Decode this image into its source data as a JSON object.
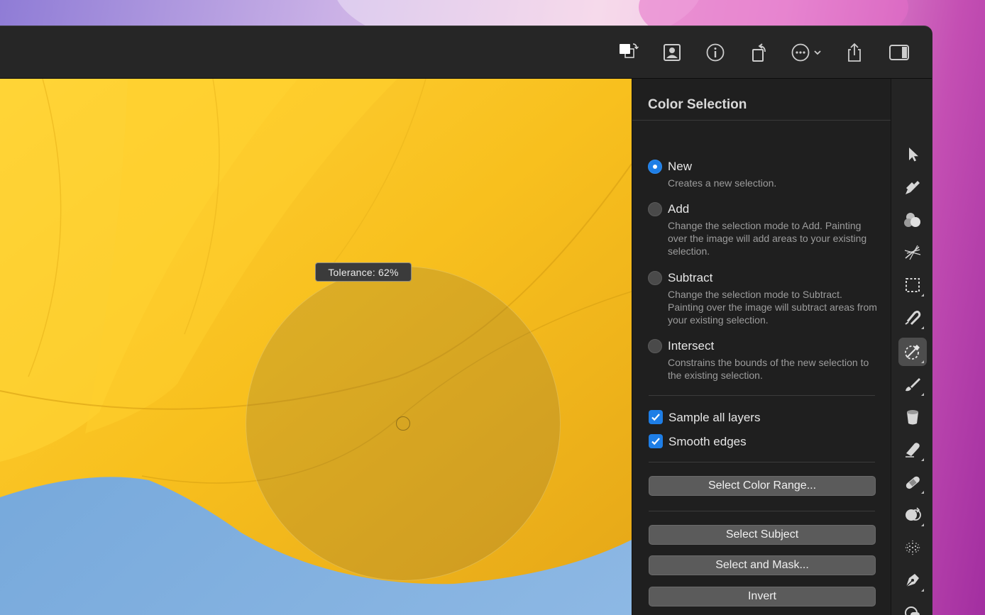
{
  "toolbar": {
    "buttons": [
      {
        "name": "swap-colors-icon"
      },
      {
        "name": "portrait-icon"
      },
      {
        "name": "info-icon"
      },
      {
        "name": "rotate-icon"
      },
      {
        "name": "more-options-icon"
      },
      {
        "name": "share-icon"
      },
      {
        "name": "sidebar-toggle-icon"
      }
    ]
  },
  "canvas": {
    "tooltip": "Tolerance: 62%"
  },
  "panel": {
    "title": "Color Selection",
    "modes": [
      {
        "label": "New",
        "desc": "Creates a new selection.",
        "selected": true
      },
      {
        "label": "Add",
        "desc": "Change the selection mode to Add. Painting over the image will add areas to your existing selection.",
        "selected": false
      },
      {
        "label": "Subtract",
        "desc": "Change the selection mode to Subtract. Painting over the image will subtract areas from your existing selection.",
        "selected": false
      },
      {
        "label": "Intersect",
        "desc": "Constrains the bounds of the new selection to the existing selection.",
        "selected": false
      }
    ],
    "checkboxes": [
      {
        "label": "Sample all layers",
        "checked": true
      },
      {
        "label": "Smooth edges",
        "checked": true
      }
    ],
    "buttons": {
      "color_range": "Select Color Range...",
      "subject": "Select Subject",
      "mask": "Select and Mask...",
      "invert": "Invert"
    }
  },
  "tools": [
    "arrow-pointer-icon",
    "paint-roller-icon",
    "color-adjust-icon",
    "sparkle-effects-icon",
    "rectangle-select-icon",
    "magnetic-lasso-icon",
    "color-select-icon",
    "brush-icon",
    "paint-bucket-icon",
    "eraser-icon",
    "bandage-repair-icon",
    "clone-icon",
    "noise-icon",
    "pen-icon",
    "shapes-icon"
  ],
  "colors": {
    "accent": "#1e7ee6",
    "panel_bg": "#1f1f1f",
    "canvas_yellow": "#f6c21f",
    "canvas_blue": "#7aa8d8"
  }
}
